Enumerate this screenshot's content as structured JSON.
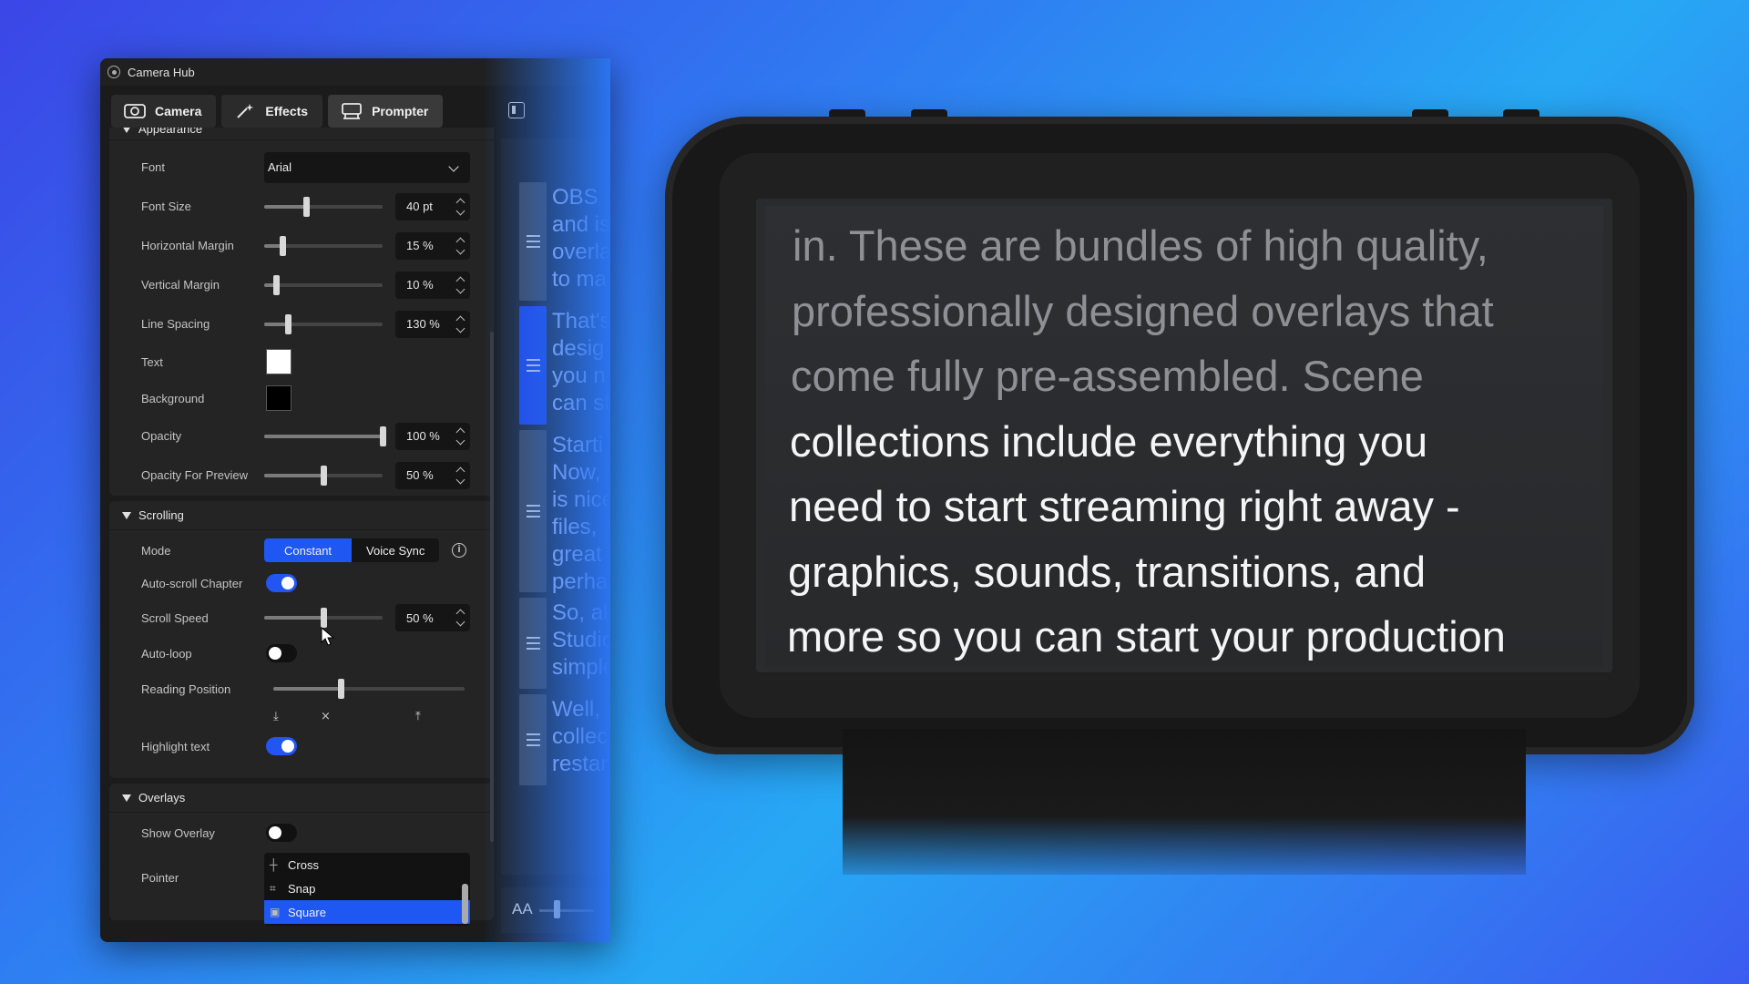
{
  "window": {
    "title": "Camera Hub"
  },
  "tabs": [
    {
      "label": "Camera",
      "icon": "camera-icon"
    },
    {
      "label": "Effects",
      "icon": "magic-wand-icon"
    },
    {
      "label": "Prompter",
      "icon": "prompter-icon"
    }
  ],
  "appearance": {
    "header": "Appearance",
    "font": {
      "label": "Font",
      "value": "Arial"
    },
    "font_size": {
      "label": "Font Size",
      "value": "40 pt",
      "level": 0.35
    },
    "horizontal_margin": {
      "label": "Horizontal Margin",
      "value": "15 %",
      "level": 0.15
    },
    "vertical_margin": {
      "label": "Vertical Margin",
      "value": "10 %",
      "level": 0.1
    },
    "line_spacing": {
      "label": "Line Spacing",
      "value": "130 %",
      "level": 0.2
    },
    "text": {
      "label": "Text",
      "color": "#ffffff"
    },
    "background": {
      "label": "Background",
      "color": "#000000"
    },
    "opacity": {
      "label": "Opacity",
      "value": "100 %",
      "level": 1.0
    },
    "opacity_preview": {
      "label": "Opacity For Preview",
      "value": "50 %",
      "level": 0.5
    }
  },
  "scrolling": {
    "header": "Scrolling",
    "mode": {
      "label": "Mode",
      "options": [
        "Constant",
        "Voice Sync"
      ],
      "selected": "Constant"
    },
    "auto_scroll_chapter": {
      "label": "Auto-scroll Chapter",
      "on": true
    },
    "scroll_speed": {
      "label": "Scroll Speed",
      "value": "50 %",
      "level": 0.5
    },
    "auto_loop": {
      "label": "Auto-loop",
      "on": false
    },
    "reading_position": {
      "label": "Reading Position",
      "level": 0.35
    },
    "highlight_text": {
      "label": "Highlight text",
      "on": true
    }
  },
  "overlays": {
    "header": "Overlays",
    "show_overlay": {
      "label": "Show Overlay",
      "on": false
    },
    "pointer": {
      "label": "Pointer",
      "options": [
        "Cross",
        "Snap",
        "Square"
      ],
      "selected": "Square"
    }
  },
  "script_chapters": [
    {
      "lines": [
        "OBS",
        "and is",
        "overla",
        "to ma"
      ],
      "active": false
    },
    {
      "lines": [
        "That's",
        "desig",
        "you n",
        "can st"
      ],
      "active": true
    },
    {
      "lines": [
        "Starti",
        "Now,",
        "is nice",
        "files,",
        "great",
        "perha"
      ],
      "active": false
    },
    {
      "lines": [
        "So, al",
        "Studio",
        "simple"
      ],
      "active": false
    },
    {
      "lines": [
        "Well,",
        "collec",
        "restar"
      ],
      "active": false
    }
  ],
  "script_footer": {
    "font_size_icon": "AA"
  },
  "prompter_text": {
    "read_lines": [
      "in. These are bundles of high quality,",
      "professionally designed overlays that",
      "come fully pre-assembled. Scene"
    ],
    "upcoming_lines": [
      "collections include everything you",
      "need to start streaming right away -",
      "graphics, sounds, transitions, and",
      "more so you can start your production"
    ]
  },
  "colors": {
    "accent": "#1f57f2",
    "background_gradient": [
      "#3b46e6",
      "#27a8f4"
    ]
  }
}
